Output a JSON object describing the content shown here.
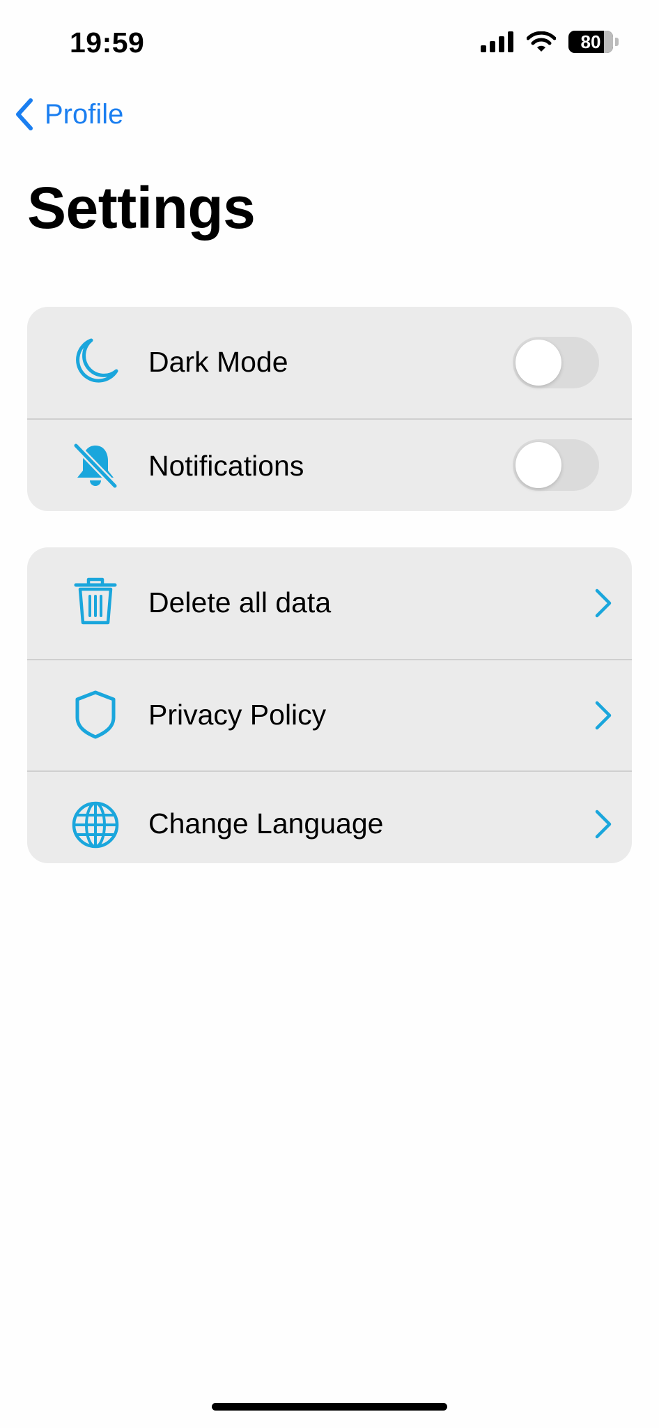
{
  "status_bar": {
    "time": "19:59",
    "battery": "80",
    "battery_level": 0.8,
    "icons": [
      "cellular-signal-icon",
      "wifi-icon",
      "battery-icon"
    ]
  },
  "nav": {
    "back_label": "Profile",
    "back_icon": "chevron-left-icon"
  },
  "page": {
    "title": "Settings"
  },
  "colors": {
    "accent": "#1a7ef0",
    "icon": "#1aa6dc",
    "group_bg": "#ebebeb",
    "toggle_off": "#dbdbdb"
  },
  "toggle_group": [
    {
      "label": "Dark Mode",
      "icon": "moon-icon",
      "enabled": false
    },
    {
      "label": "Notifications",
      "icon": "bell-slash-icon",
      "enabled": false
    }
  ],
  "link_group": [
    {
      "label": "Delete all data",
      "icon": "trash-icon",
      "accessory": "chevron-right-icon"
    },
    {
      "label": "Privacy Policy",
      "icon": "shield-icon",
      "accessory": "chevron-right-icon"
    },
    {
      "label": "Change Language",
      "icon": "globe-icon",
      "accessory": "chevron-right-icon"
    }
  ]
}
